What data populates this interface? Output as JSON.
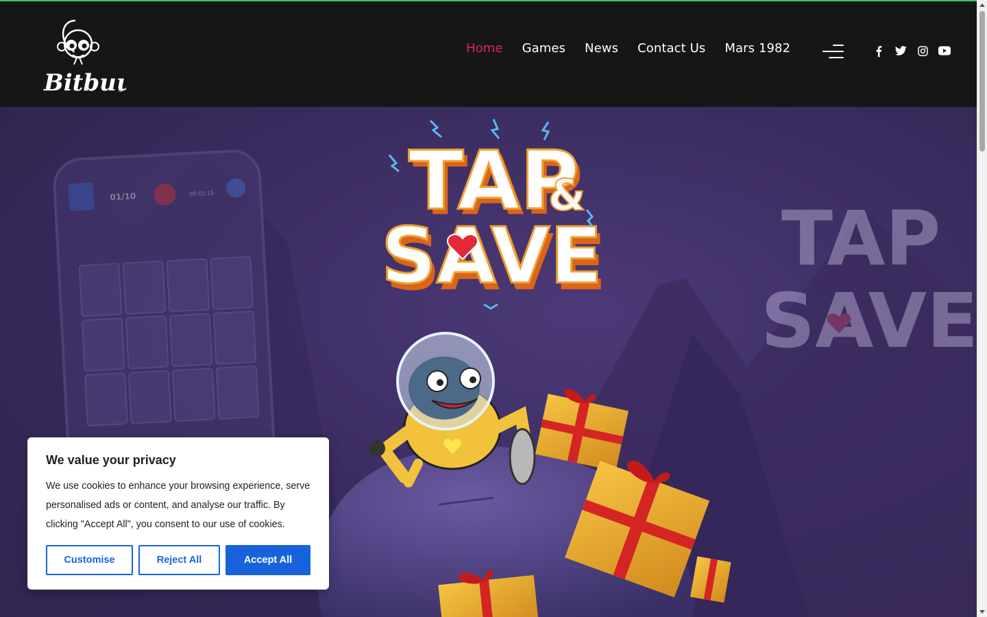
{
  "brand": {
    "logo_text": "Bitbuu",
    "registered_mark": "®"
  },
  "nav": {
    "items": [
      {
        "label": "Home",
        "active": true
      },
      {
        "label": "Games",
        "active": false
      },
      {
        "label": "News",
        "active": false
      },
      {
        "label": "Contact Us",
        "active": false
      },
      {
        "label": "Mars 1982",
        "active": false
      }
    ],
    "menu_icon": "hamburger-menu-icon"
  },
  "socials": [
    {
      "name": "facebook-icon"
    },
    {
      "name": "twitter-icon"
    },
    {
      "name": "instagram-icon"
    },
    {
      "name": "youtube-icon"
    }
  ],
  "hero": {
    "game_title_line1": "TAP",
    "game_title_amp": "&",
    "game_title_line2": "SAVE",
    "phone_counter": "01/10",
    "phone_timer": "00:01:15"
  },
  "cookie": {
    "title": "We value your privacy",
    "text": "We use cookies to enhance your browsing experience, serve personalised ads or content, and analyse our traffic. By clicking \"Accept All\", you consent to our use of cookies.",
    "customise_label": "Customise",
    "reject_label": "Reject All",
    "accept_label": "Accept All"
  },
  "colors": {
    "accent_nav_active": "#e0245e",
    "header_bg": "#161616",
    "top_line": "#2ecc71",
    "cookie_button": "#1863dc",
    "hero_bg": "#3c2d62"
  }
}
